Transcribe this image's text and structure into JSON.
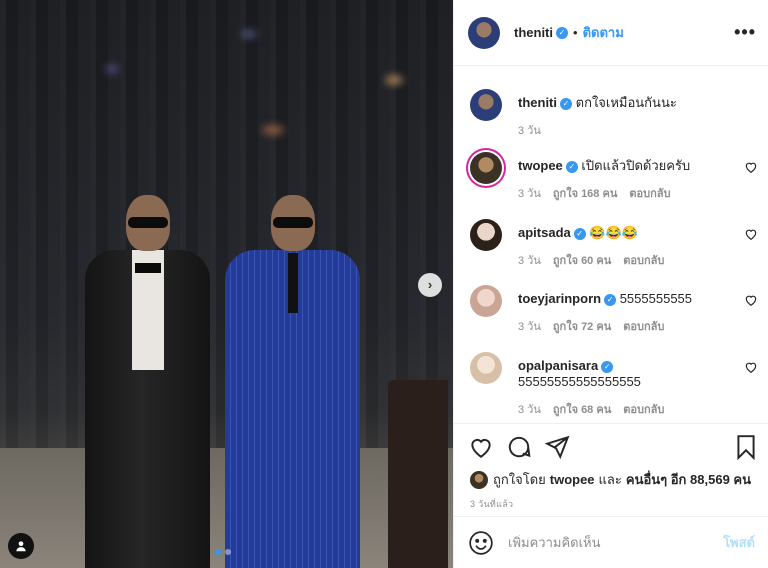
{
  "post": {
    "author": "theniti",
    "follow_label": "ติดตาม",
    "dot": "•",
    "more_label": "•••"
  },
  "caption": {
    "username": "theniti",
    "text": "ตกใจเหมือนกันนะ",
    "time": "3 วัน"
  },
  "comments": [
    {
      "username": "twopee",
      "verified": true,
      "text": "เปิดแล้วปิดด้วยครับ",
      "time": "3 วัน",
      "likes": "ถูกใจ 168 คน",
      "reply": "ตอบกลับ"
    },
    {
      "username": "apitsada",
      "verified": true,
      "text": "😂😂😂",
      "time": "3 วัน",
      "likes": "ถูกใจ 60 คน",
      "reply": "ตอบกลับ"
    },
    {
      "username": "toeyjarinporn",
      "verified": true,
      "text": "5555555555",
      "time": "3 วัน",
      "likes": "ถูกใจ 72 คน",
      "reply": "ตอบกลับ"
    },
    {
      "username": "opalpanisara",
      "verified": true,
      "text": "55555555555555555",
      "time": "3 วัน",
      "likes": "ถูกใจ 68 คน",
      "reply": "ตอบกลับ"
    }
  ],
  "likes_line": {
    "prefix": "ถูกใจโดย",
    "user": "twopee",
    "and": "และ",
    "others": "คนอื่นๆ อีก 88,569 คน"
  },
  "time_ago": "3 วันที่แล้ว",
  "add_comment": {
    "placeholder": "เพิ่มความคิดเห็น",
    "post_label": "โพสต์"
  },
  "carousel": {
    "next_label": "›",
    "slide_index": 1,
    "slide_count": 2
  },
  "colors": {
    "accent": "#3897f0",
    "post_disabled": "#b2dffc"
  },
  "icons": [
    "heart-icon",
    "comment-icon",
    "share-icon",
    "bookmark-icon",
    "emoji-icon",
    "chevron-right-icon",
    "user-tag-icon",
    "verified-icon"
  ]
}
